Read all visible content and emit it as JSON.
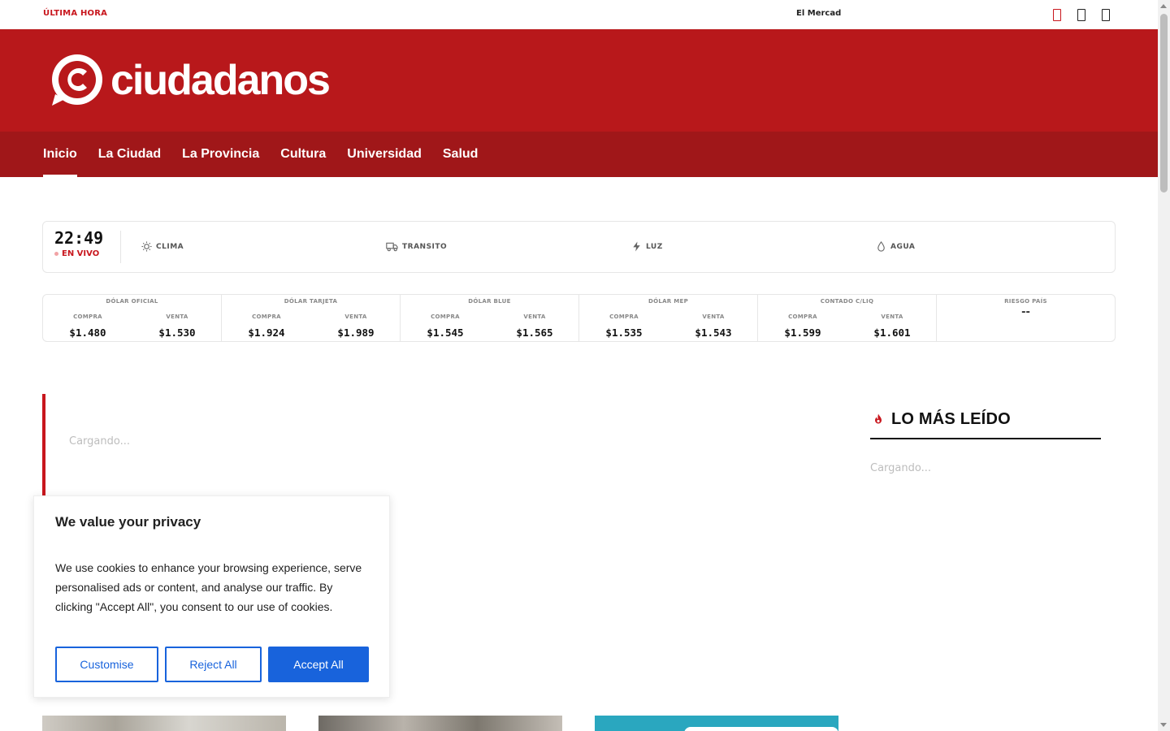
{
  "topbar": {
    "ticker_label": "ÚLTIMA HORA",
    "ticker_text": "El Mercad"
  },
  "brand": {
    "name": "ciudadanos",
    "primary_color": "#b8181b",
    "nav_color": "#a01719"
  },
  "nav": {
    "items": [
      {
        "label": "Inicio",
        "active": true
      },
      {
        "label": "La Ciudad"
      },
      {
        "label": "La Provincia"
      },
      {
        "label": "Cultura"
      },
      {
        "label": "Universidad"
      },
      {
        "label": "Salud"
      }
    ]
  },
  "status": {
    "time": "22:49",
    "live_label": "EN VIVO",
    "items": [
      {
        "label": "CLIMA",
        "icon": "sun-icon"
      },
      {
        "label": "TRANSITO",
        "icon": "truck-icon"
      },
      {
        "label": "LUZ",
        "icon": "bolt-icon"
      },
      {
        "label": "AGUA",
        "icon": "drop-icon"
      }
    ]
  },
  "rates": {
    "buy_label": "COMPRA",
    "sell_label": "VENTA",
    "columns": [
      {
        "title": "DÓLAR OFICIAL",
        "buy": "$1.480",
        "sell": "$1.530"
      },
      {
        "title": "DÓLAR TARJETA",
        "buy": "$1.924",
        "sell": "$1.989"
      },
      {
        "title": "DÓLAR BLUE",
        "buy": "$1.545",
        "sell": "$1.565"
      },
      {
        "title": "DÓLAR MEP",
        "buy": "$1.535",
        "sell": "$1.543"
      },
      {
        "title": "CONTADO C/LIQ",
        "buy": "$1.599",
        "sell": "$1.601"
      }
    ],
    "risk": {
      "title": "RIESGO PAÍS",
      "value": "--"
    }
  },
  "featured": {
    "loading_text": "Cargando..."
  },
  "most_read": {
    "title": "LO MÁS LEÍDO",
    "loading_text": "Cargando..."
  },
  "cookie": {
    "title": "We value your privacy",
    "text": "We use cookies to enhance your browsing experience, serve personalised ads or content, and analyse our traffic. By clicking \"Accept All\", you consent to our use of cookies.",
    "customise_label": "Customise",
    "reject_label": "Reject All",
    "accept_label": "Accept All",
    "accent_color": "#1863dc"
  }
}
